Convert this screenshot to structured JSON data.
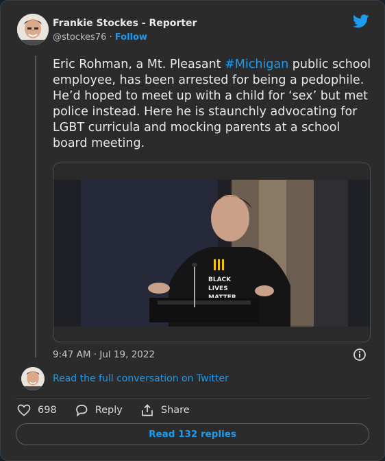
{
  "author": {
    "name": "Frankie Stockes - Reporter",
    "handle": "@stockes76",
    "separator": "·",
    "follow_label": "Follow"
  },
  "tweet": {
    "text_before": "Eric Rohman, a Mt. Pleasant ",
    "hashtag": "#Michigan",
    "text_after": " public school employee, has been arrested for being a pedophile. He’d hoped to meet up with a child for ‘sex’ but met police instead. Here he is staunchly advocating for LGBT curricula and mocking parents at a school board meeting.",
    "timestamp": "9:47 AM · Jul 19, 2022"
  },
  "media": {
    "shirt_lines": [
      "BLACK",
      "LIVES",
      "MATTER"
    ]
  },
  "conversation": {
    "link_label": "Read the full conversation on Twitter"
  },
  "actions": {
    "like_count": "698",
    "reply_label": "Reply",
    "share_label": "Share"
  },
  "footer": {
    "read_replies_label": "Read 132 replies"
  },
  "colors": {
    "accent": "#1d9bf0",
    "background": "#2b2b2b"
  }
}
